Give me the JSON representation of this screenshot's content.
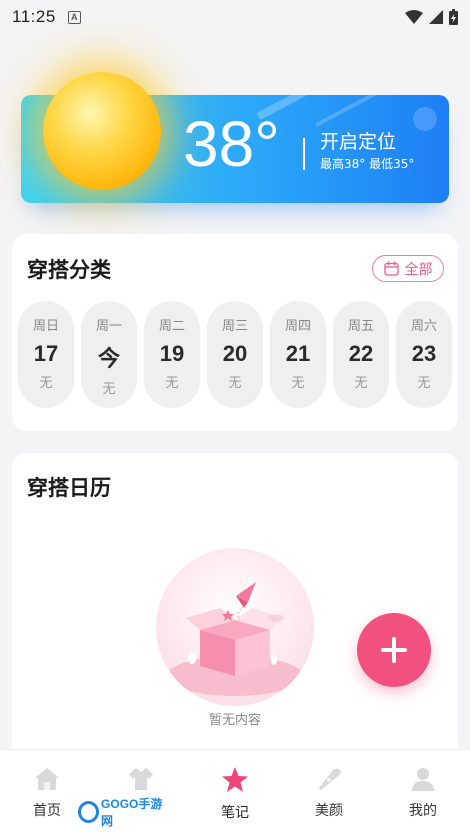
{
  "status": {
    "time": "11:25",
    "badge": "A"
  },
  "weather": {
    "temperature": "38°",
    "location_label": "开启定位",
    "range": "最高38°  最低35°"
  },
  "category": {
    "title": "穿搭分类",
    "all_label": "全部",
    "days": [
      {
        "weekday": "周日",
        "date": "17",
        "status": "无"
      },
      {
        "weekday": "周一",
        "date": "今",
        "status": "无"
      },
      {
        "weekday": "周二",
        "date": "19",
        "status": "无"
      },
      {
        "weekday": "周三",
        "date": "20",
        "status": "无"
      },
      {
        "weekday": "周四",
        "date": "21",
        "status": "无"
      },
      {
        "weekday": "周五",
        "date": "22",
        "status": "无"
      },
      {
        "weekday": "周六",
        "date": "23",
        "status": "无"
      }
    ]
  },
  "calendar": {
    "title": "穿搭日历",
    "empty_text": "暂无内容"
  },
  "tabbar": {
    "tabs": [
      {
        "label": "首页",
        "icon": "home-icon"
      },
      {
        "label": "",
        "icon": "shirt-icon"
      },
      {
        "label": "笔记",
        "icon": "star-icon"
      },
      {
        "label": "美颜",
        "icon": "pen-icon"
      },
      {
        "label": "我的",
        "icon": "user-icon"
      }
    ]
  },
  "watermark": {
    "text": "GOGO手游网"
  },
  "colors": {
    "accent_pink": "#f1517f",
    "weather_blue": "#2ba6f8",
    "sun_yellow": "#ffc21a"
  }
}
